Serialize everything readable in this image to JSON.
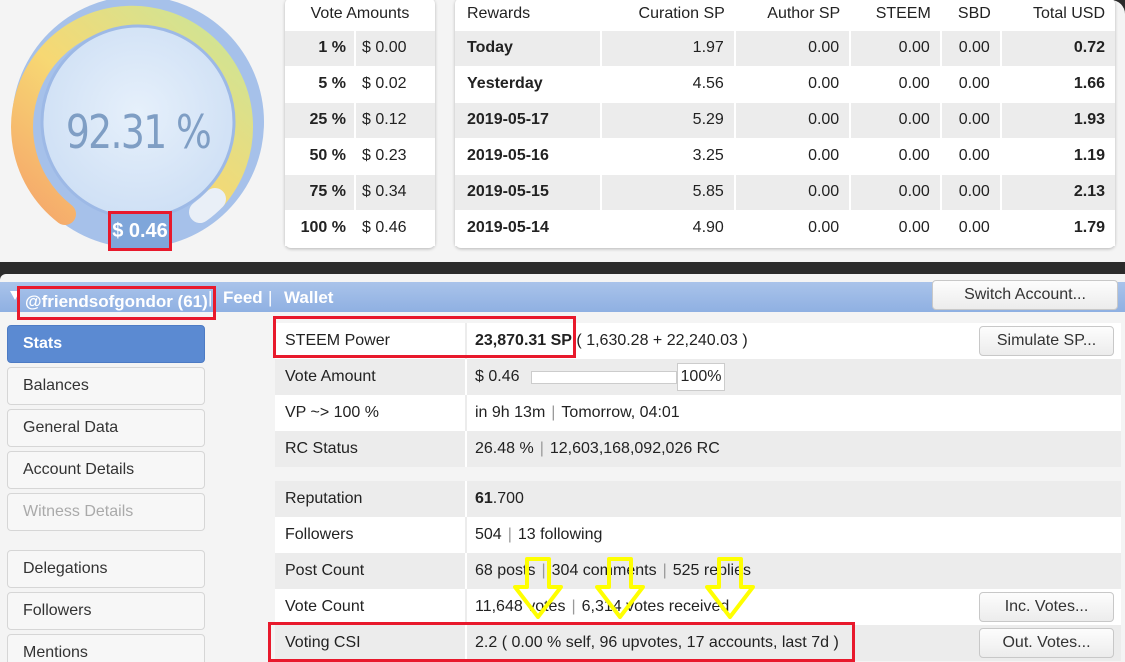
{
  "gauge": {
    "value_text": "92.31 %",
    "value_pct": 92.31,
    "usd_text": "$ 0.46"
  },
  "vote_amounts": {
    "header": "Vote Amounts",
    "rows": [
      {
        "pct": "1 %",
        "usd": "$ 0.00"
      },
      {
        "pct": "5 %",
        "usd": "$ 0.02"
      },
      {
        "pct": "25 %",
        "usd": "$ 0.12"
      },
      {
        "pct": "50 %",
        "usd": "$ 0.23"
      },
      {
        "pct": "75 %",
        "usd": "$ 0.34"
      },
      {
        "pct": "100 %",
        "usd": "$ 0.46"
      }
    ]
  },
  "rewards": {
    "headers": [
      "Rewards",
      "Curation SP",
      "Author SP",
      "STEEM",
      "SBD",
      "Total USD"
    ],
    "rows": [
      [
        "Today",
        "1.97",
        "0.00",
        "0.00",
        "0.00",
        "0.72"
      ],
      [
        "Yesterday",
        "4.56",
        "0.00",
        "0.00",
        "0.00",
        "1.66"
      ],
      [
        "2019-05-17",
        "5.29",
        "0.00",
        "0.00",
        "0.00",
        "1.93"
      ],
      [
        "2019-05-16",
        "3.25",
        "0.00",
        "0.00",
        "0.00",
        "1.19"
      ],
      [
        "2019-05-15",
        "5.85",
        "0.00",
        "0.00",
        "0.00",
        "2.13"
      ],
      [
        "2019-05-14",
        "4.90",
        "0.00",
        "0.00",
        "0.00",
        "1.79"
      ]
    ]
  },
  "account_bar": {
    "account": "@friendsofgondor (61)",
    "sep": "|",
    "feed": "Feed",
    "wallet": "Wallet",
    "switch_button": "Switch Account..."
  },
  "sidebar": {
    "items": [
      {
        "label": "Stats"
      },
      {
        "label": "Balances"
      },
      {
        "label": "General Data"
      },
      {
        "label": "Account Details"
      },
      {
        "label": "Witness Details"
      },
      {
        "label": "Delegations"
      },
      {
        "label": "Followers"
      },
      {
        "label": "Mentions"
      }
    ]
  },
  "stats": {
    "steem_power": {
      "label": "STEEM Power",
      "value_bold": "23,870.31 SP",
      "value_rest": "( 1,630.28 + 22,240.03 )",
      "button": "Simulate SP..."
    },
    "vote_amount": {
      "label": "Vote Amount",
      "value": "$ 0.46",
      "slider_text": "100%",
      "slider_pct": 100
    },
    "vp": {
      "label": "VP ~> 100 %",
      "value_a": "in 9h 13m",
      "sep": "|",
      "value_b": "Tomorrow, 04:01"
    },
    "rc": {
      "label": "RC Status",
      "value_a": "26.48 %",
      "sep": "|",
      "value_b": "12,603,168,092,026 RC"
    },
    "reputation": {
      "label": "Reputation",
      "value_bold": "61",
      "value_rest": ".700"
    },
    "followers": {
      "label": "Followers",
      "value_a": "504",
      "sep": "|",
      "value_b": "13 following"
    },
    "post_count": {
      "label": "Post Count",
      "value_a": "68 posts",
      "sep": "|",
      "value_b": "304 comments",
      "value_c": "525 replies"
    },
    "vote_count": {
      "label": "Vote Count",
      "value_a": "11,648 votes",
      "sep": "|",
      "value_b": "6,314 votes received",
      "button": "Inc. Votes..."
    },
    "voting_csi": {
      "label": "Voting CSI",
      "value": "2.2 ( 0.00 % self, 96 upvotes, 17 accounts, last 7d )",
      "button": "Out. Votes..."
    }
  },
  "colors": {
    "highlight": "#e8192c",
    "arrow": "#ffff00",
    "accent": "#5b8ad2"
  }
}
